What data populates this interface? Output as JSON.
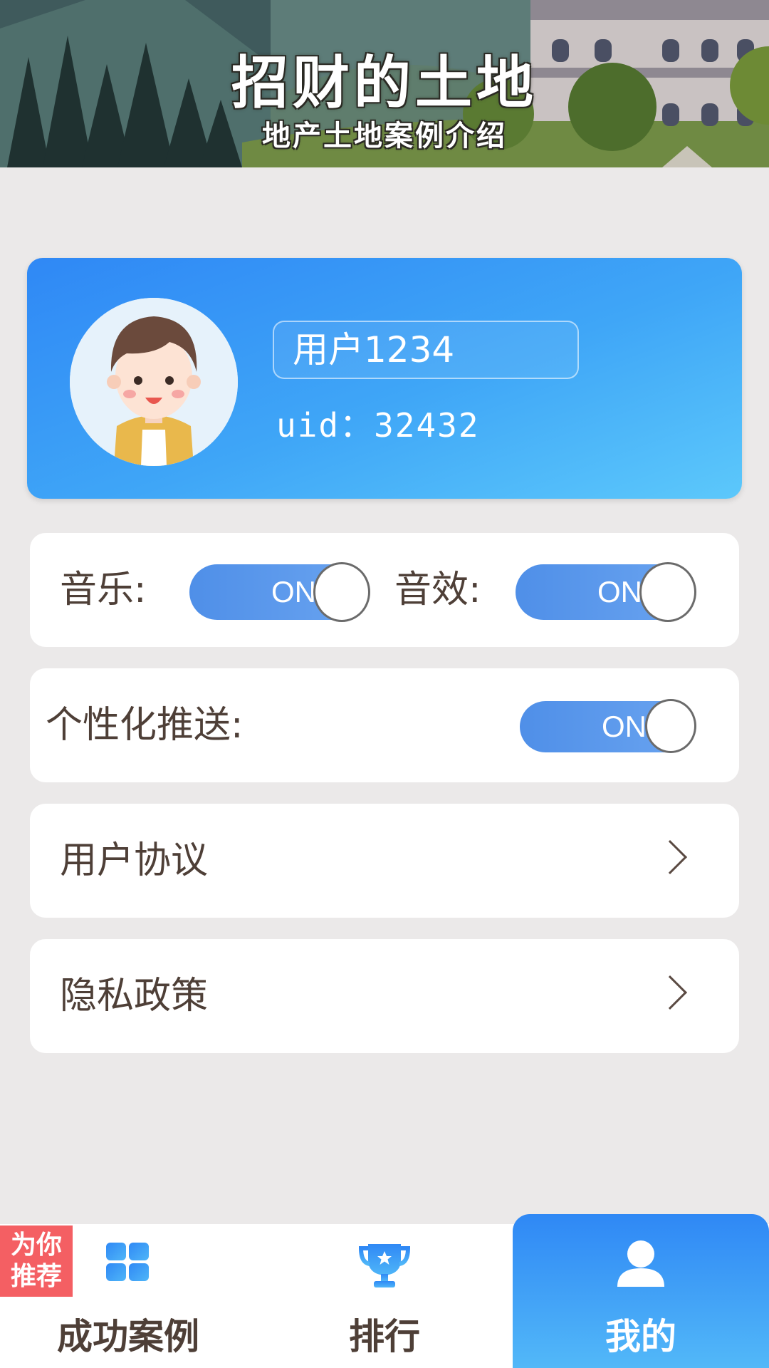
{
  "header": {
    "title": "招财的土地",
    "subtitle": "地产土地案例介绍"
  },
  "profile": {
    "username": "用户1234",
    "uid_label": "uid：",
    "uid_value": "32432"
  },
  "settings": {
    "music_label": "音乐:",
    "music_state": "ON",
    "sfx_label": "音效:",
    "sfx_state": "ON",
    "push_label": "个性化推送:",
    "push_state": "ON",
    "user_agreement": "用户协议",
    "privacy_policy": "隐私政策"
  },
  "nav": {
    "promo_badge": "为你推荐",
    "items": [
      {
        "label": "成功案例",
        "icon": "grid-icon"
      },
      {
        "label": "排行",
        "icon": "trophy-icon"
      },
      {
        "label": "我的",
        "icon": "user-icon",
        "active": true
      }
    ]
  },
  "colors": {
    "accent_blue": "#2f88f5",
    "toggle_blue": "#5b98ec",
    "promo_red": "#f45f63",
    "text_brown": "#4e3f37",
    "page_background": "#ebe9e9"
  }
}
